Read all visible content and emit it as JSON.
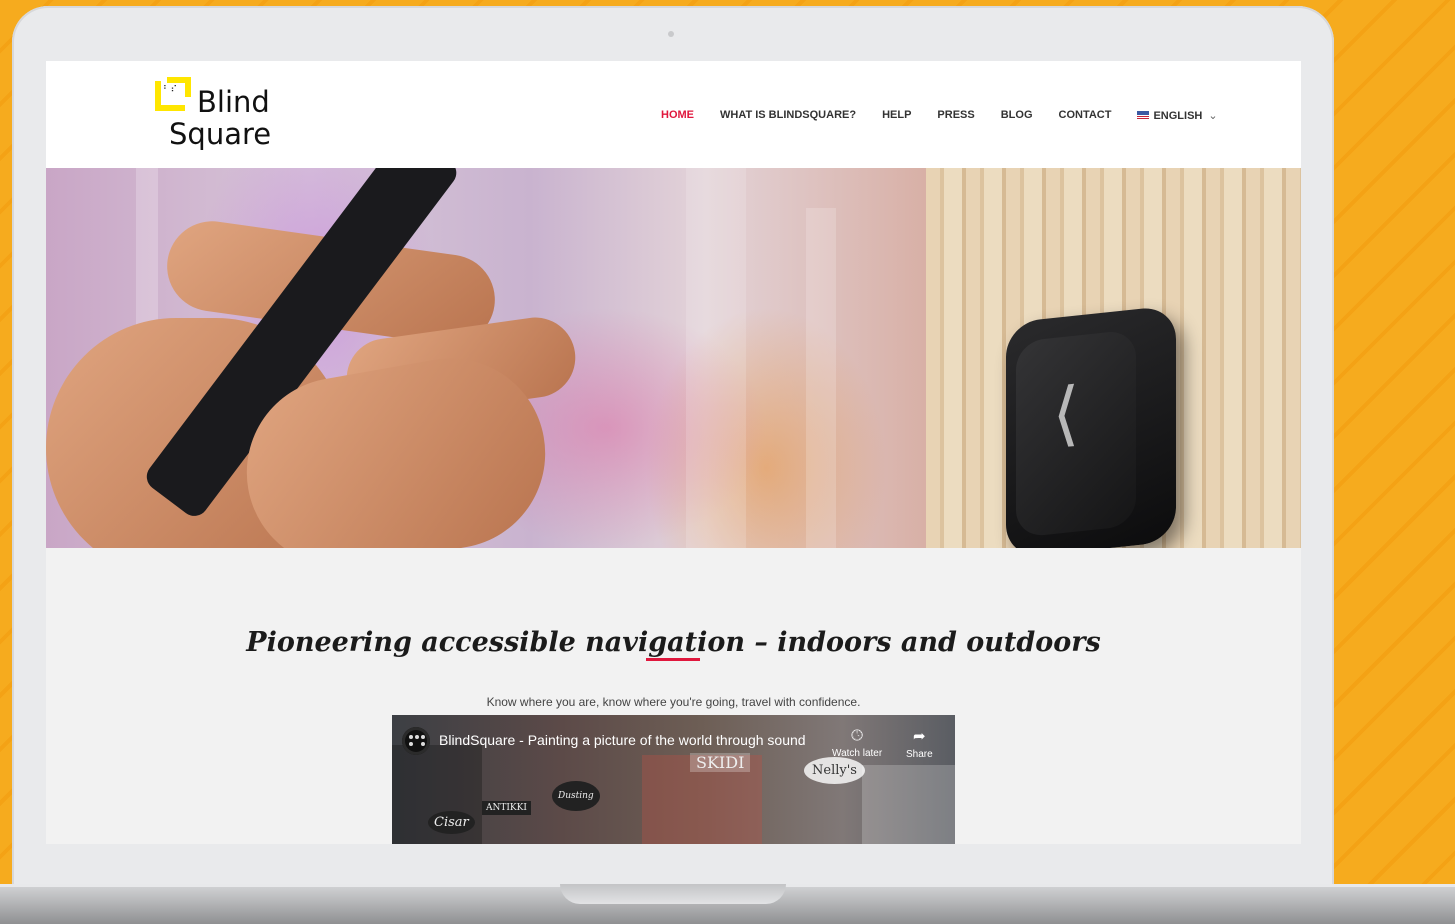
{
  "site": {
    "logo": {
      "line1": "Blind",
      "line2": "Square",
      "braille": "⠃⠎"
    },
    "nav": [
      {
        "label": "HOME",
        "active": true
      },
      {
        "label": "WHAT IS BLINDSQUARE?",
        "active": false
      },
      {
        "label": "HELP",
        "active": false
      },
      {
        "label": "PRESS",
        "active": false
      },
      {
        "label": "BLOG",
        "active": false
      },
      {
        "label": "CONTACT",
        "active": false
      },
      {
        "label": "ENGLISH",
        "active": false,
        "dropdown": true
      }
    ],
    "headline": "Pioneering accessible navigation – indoors and outdoors",
    "subheadline": "Know where you are, know where you're going, travel with confidence.",
    "video": {
      "title": "BlindSquare - Painting a picture of the world through sound",
      "watch_later": "Watch later",
      "share": "Share",
      "signs": [
        "SKIDI",
        "Nelly's",
        "ANTIKKI",
        "Cisar",
        "Dusting"
      ]
    },
    "colors": {
      "accent": "#e0173d",
      "brand_yellow": "#ffe600",
      "background_orange": "#f5a81c"
    }
  }
}
